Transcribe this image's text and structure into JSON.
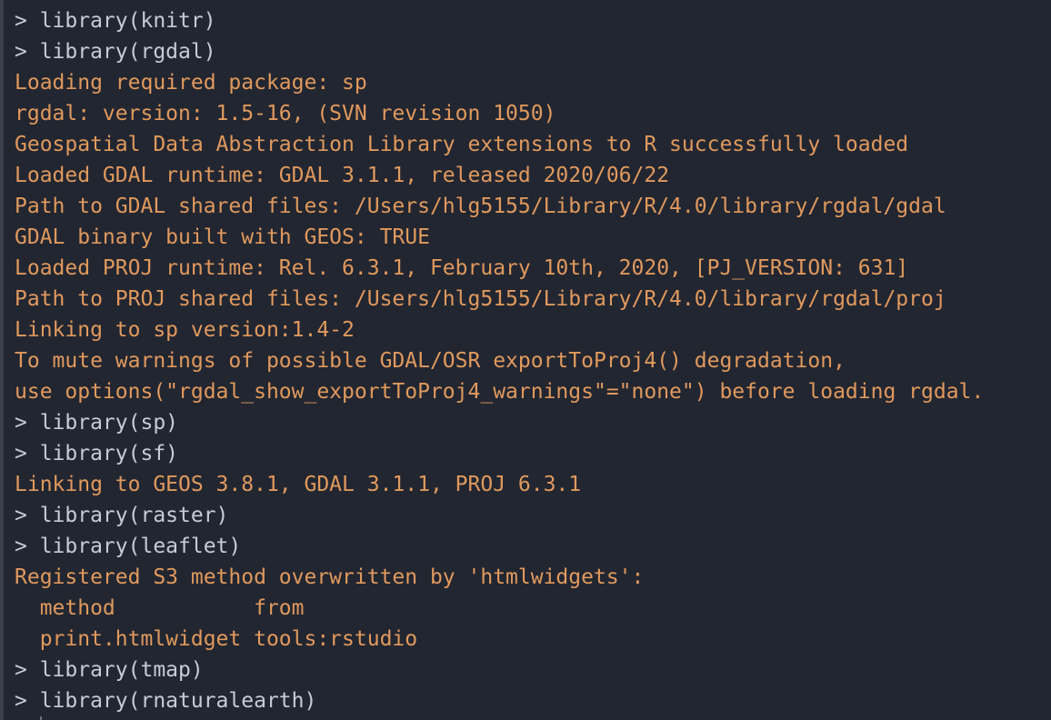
{
  "console": {
    "lines": [
      {
        "kind": "input",
        "text": "> library(knitr)"
      },
      {
        "kind": "input",
        "text": "> library(rgdal)"
      },
      {
        "kind": "output",
        "text": "Loading required package: sp"
      },
      {
        "kind": "output",
        "text": "rgdal: version: 1.5-16, (SVN revision 1050)"
      },
      {
        "kind": "output",
        "text": "Geospatial Data Abstraction Library extensions to R successfully loaded"
      },
      {
        "kind": "output",
        "text": "Loaded GDAL runtime: GDAL 3.1.1, released 2020/06/22"
      },
      {
        "kind": "output",
        "text": "Path to GDAL shared files: /Users/hlg5155/Library/R/4.0/library/rgdal/gdal"
      },
      {
        "kind": "output",
        "text": "GDAL binary built with GEOS: TRUE"
      },
      {
        "kind": "output",
        "text": "Loaded PROJ runtime: Rel. 6.3.1, February 10th, 2020, [PJ_VERSION: 631]"
      },
      {
        "kind": "output",
        "text": "Path to PROJ shared files: /Users/hlg5155/Library/R/4.0/library/rgdal/proj"
      },
      {
        "kind": "output",
        "text": "Linking to sp version:1.4-2"
      },
      {
        "kind": "output",
        "text": "To mute warnings of possible GDAL/OSR exportToProj4() degradation,"
      },
      {
        "kind": "output",
        "text": "use options(\"rgdal_show_exportToProj4_warnings\"=\"none\") before loading rgdal."
      },
      {
        "kind": "input",
        "text": "> library(sp)"
      },
      {
        "kind": "input",
        "text": "> library(sf)"
      },
      {
        "kind": "output",
        "text": "Linking to GEOS 3.8.1, GDAL 3.1.1, PROJ 6.3.1"
      },
      {
        "kind": "input",
        "text": "> library(raster)"
      },
      {
        "kind": "input",
        "text": "> library(leaflet)"
      },
      {
        "kind": "output",
        "text": "Registered S3 method overwritten by 'htmlwidgets':"
      },
      {
        "kind": "output",
        "text": "  method           from         "
      },
      {
        "kind": "output",
        "text": "  print.htmlwidget tools:rstudio"
      },
      {
        "kind": "input",
        "text": "> library(tmap)"
      },
      {
        "kind": "input",
        "text": "> library(rnaturalearth)"
      }
    ]
  },
  "colors": {
    "background": "#222631",
    "input_text": "#c7cbd6",
    "output_text": "#e0995d"
  }
}
